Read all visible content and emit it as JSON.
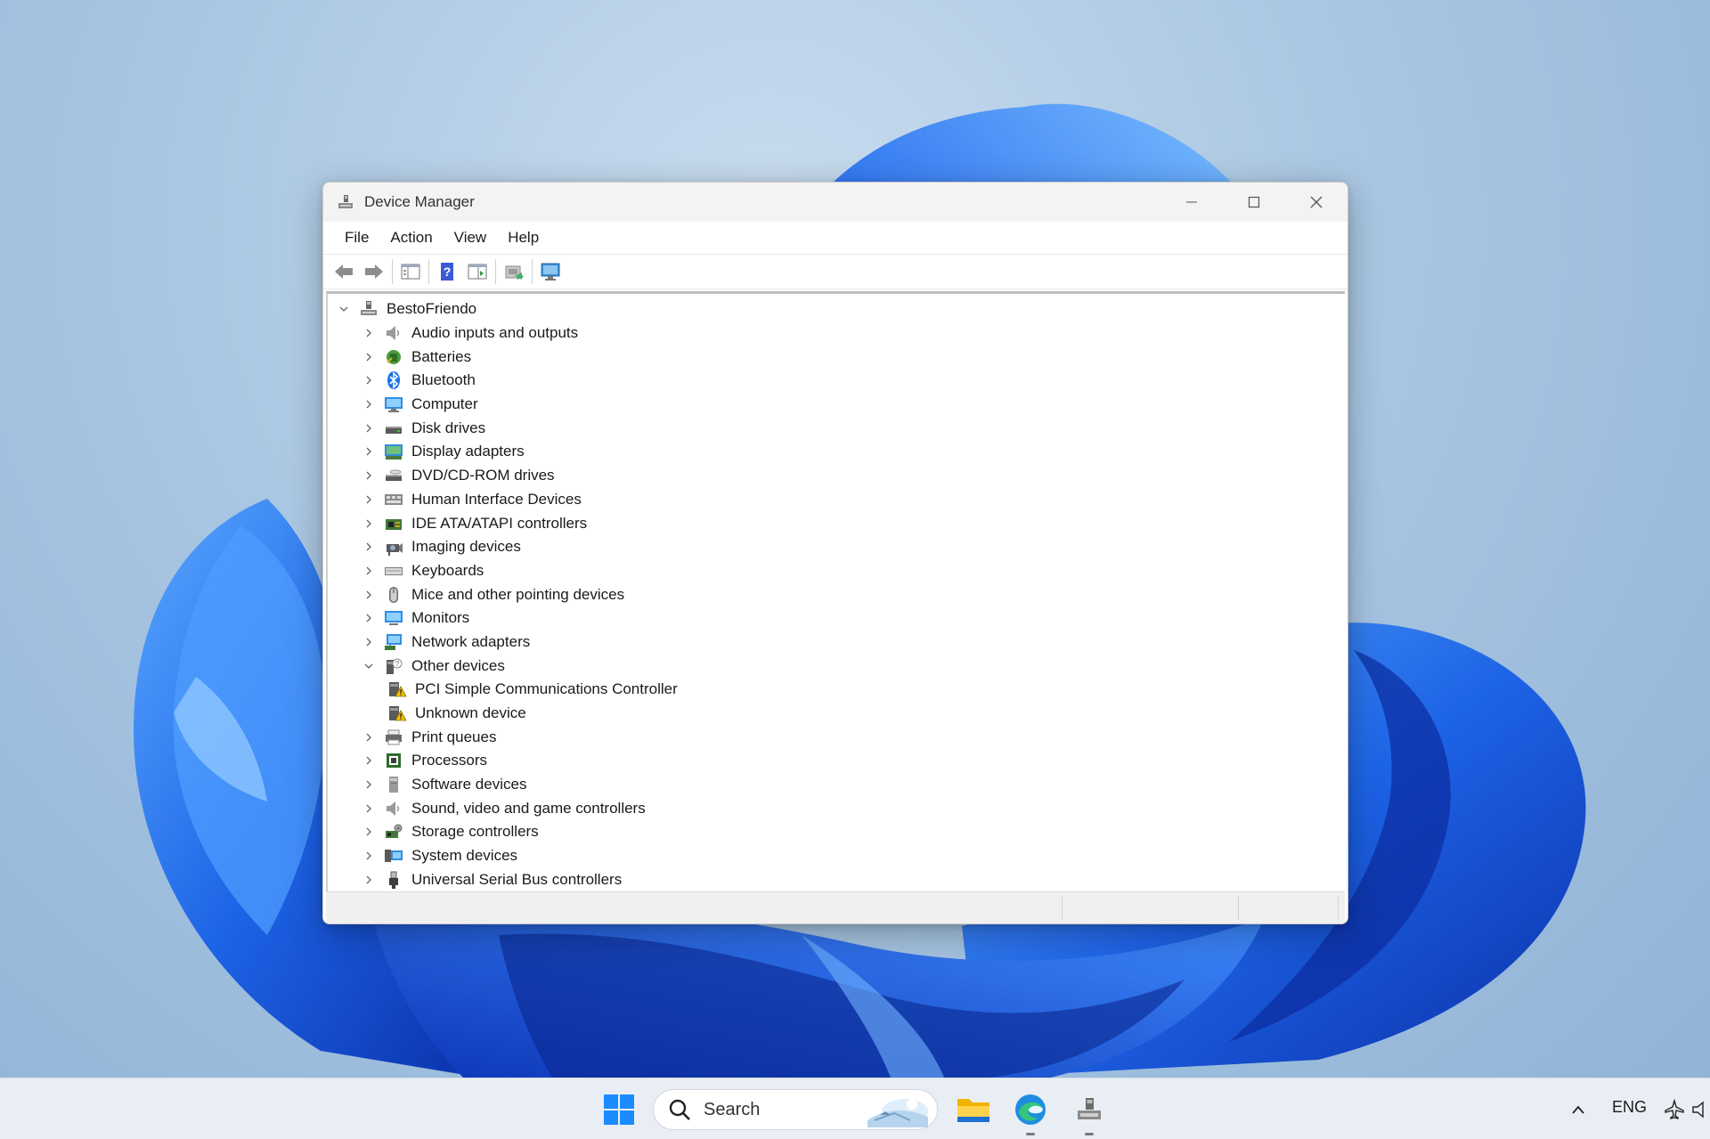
{
  "window": {
    "title": "Device Manager",
    "menu": [
      "File",
      "Action",
      "View",
      "Help"
    ]
  },
  "toolbar": {
    "buttons": [
      "back",
      "forward",
      "show-hide-console-tree",
      "help",
      "properties",
      "update-driver",
      "scan-hardware"
    ]
  },
  "tree": {
    "root": "BestoFriendo",
    "categories": [
      {
        "label": "Audio inputs and outputs",
        "icon": "speaker-icon"
      },
      {
        "label": "Batteries",
        "icon": "battery-icon"
      },
      {
        "label": "Bluetooth",
        "icon": "bluetooth-icon"
      },
      {
        "label": "Computer",
        "icon": "computer-icon"
      },
      {
        "label": "Disk drives",
        "icon": "disk-drive-icon"
      },
      {
        "label": "Display adapters",
        "icon": "display-adapter-icon"
      },
      {
        "label": "DVD/CD-ROM drives",
        "icon": "dvd-drive-icon"
      },
      {
        "label": "Human Interface Devices",
        "icon": "hid-icon"
      },
      {
        "label": "IDE ATA/ATAPI controllers",
        "icon": "ide-controller-icon"
      },
      {
        "label": "Imaging devices",
        "icon": "camera-icon"
      },
      {
        "label": "Keyboards",
        "icon": "keyboard-icon"
      },
      {
        "label": "Mice and other pointing devices",
        "icon": "mouse-icon"
      },
      {
        "label": "Monitors",
        "icon": "monitor-icon"
      },
      {
        "label": "Network adapters",
        "icon": "network-adapter-icon"
      },
      {
        "label": "Other devices",
        "icon": "other-devices-icon",
        "expanded": true,
        "children": [
          {
            "label": "PCI Simple Communications Controller",
            "icon": "warning-device-icon"
          },
          {
            "label": "Unknown device",
            "icon": "warning-device-icon"
          }
        ]
      },
      {
        "label": "Print queues",
        "icon": "printer-icon"
      },
      {
        "label": "Processors",
        "icon": "processor-icon"
      },
      {
        "label": "Software devices",
        "icon": "software-device-icon"
      },
      {
        "label": "Sound, video and game controllers",
        "icon": "speaker-icon"
      },
      {
        "label": "Storage controllers",
        "icon": "storage-controller-icon"
      },
      {
        "label": "System devices",
        "icon": "system-device-icon"
      },
      {
        "label": "Universal Serial Bus controllers",
        "icon": "usb-icon"
      }
    ]
  },
  "taskbar": {
    "search_placeholder": "Search",
    "language": "ENG",
    "apps": [
      "start",
      "file-explorer",
      "edge",
      "device-manager"
    ]
  },
  "colors": {
    "accent": "#0067c0",
    "wallpaper_bloom": "#1a5fe0"
  }
}
